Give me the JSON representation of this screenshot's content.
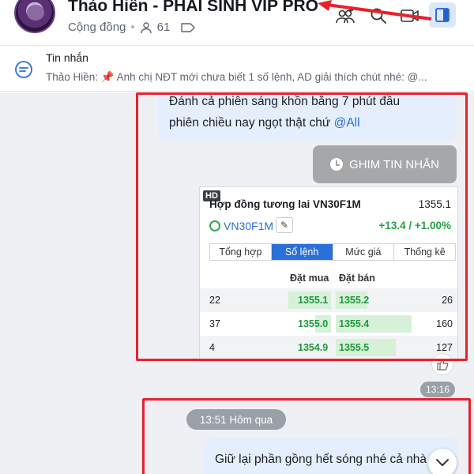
{
  "header": {
    "title": "Thảo Hiền - PHÁI SINH VIP PRO",
    "community_label": "Cộng đồng",
    "member_count": "61",
    "icons": [
      "add-members-icon",
      "search-icon",
      "video-call-icon",
      "sidebar-toggle-icon"
    ]
  },
  "pinned": {
    "title": "Tin nhắn",
    "preview": "Thảo Hiền: 📌 Anh chị NĐT mới chưa biết 1 số lệnh, AD giải thích chút nhé: @..."
  },
  "messages": {
    "m1_line1": "Đánh cả phiên sáng khồn bằng 7 phút đầu",
    "m1_line2": "phiên chiều nay ngọt thật chứ ",
    "m1_mention": "@All",
    "pin_button": "GHIM TIN NHẮN",
    "time1": "13:16",
    "date_separator": "13:51 Hôm qua",
    "m2_text": "Giữ lại phần gồng hết sóng nhé cả nhà"
  },
  "card": {
    "hd_badge": "HD",
    "title": "Hợp đồng tương lai VN30F1M",
    "price": "1355.1",
    "symbol": "VN30F1M",
    "change": "+13.4 / +1.00%",
    "tabs": [
      "Tổng hợp",
      "Sổ lệnh",
      "Mức giá",
      "Thống kê"
    ],
    "active_tab": "Sổ lệnh",
    "col_bid": "Đặt mua",
    "col_ask": "Đặt bán",
    "rows": [
      {
        "bid_vol": "22",
        "bid": "1355.1",
        "ask": "1355.2",
        "ask_vol": "26"
      },
      {
        "bid_vol": "37",
        "bid": "1355.0",
        "ask": "1355.4",
        "ask_vol": "160"
      },
      {
        "bid_vol": "4",
        "bid": "1354.9",
        "ask": "1355.5",
        "ask_vol": "127"
      }
    ]
  },
  "colors": {
    "accent": "#2b6fd8",
    "annotation_red": "#e8212e",
    "up_green": "#1d9a3d",
    "bubble": "#e5eefc"
  }
}
